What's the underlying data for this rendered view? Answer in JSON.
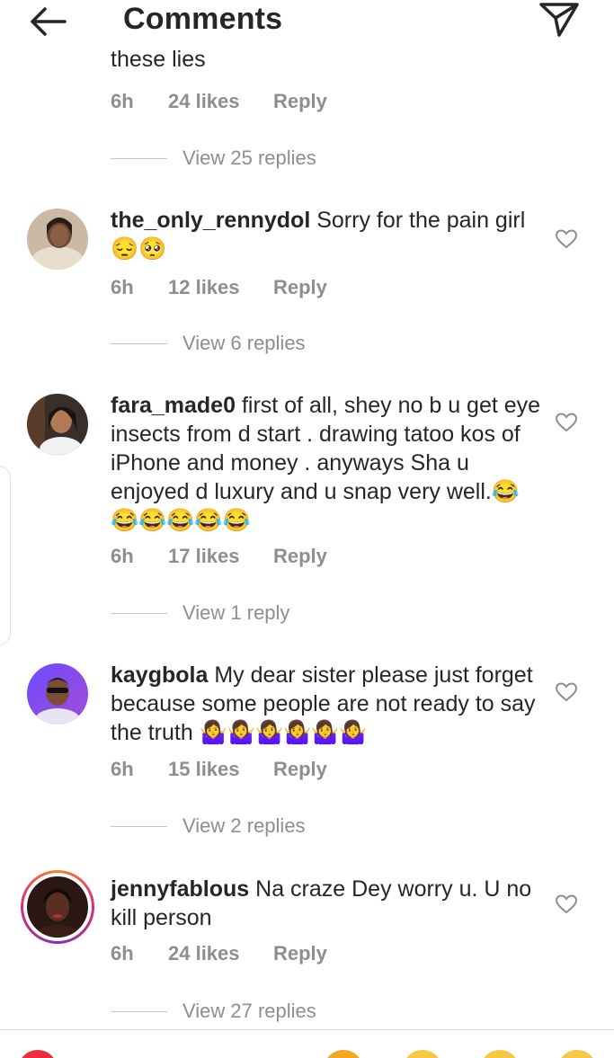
{
  "header": {
    "title": "Comments"
  },
  "prev": {
    "clipped_text": "these lies",
    "time": "6h",
    "likes": "24 likes",
    "reply": "Reply",
    "view_replies": "View 25 replies"
  },
  "comments": [
    {
      "username": "the_only_rennydol",
      "text": "Sorry for the pain girl",
      "emoji": "😔🥺",
      "time": "6h",
      "likes": "12 likes",
      "reply": "Reply",
      "view_replies": "View 6 replies"
    },
    {
      "username": "fara_made0",
      "text": "first of all, shey no b u get eye insects from d start . drawing tatoo kos of iPhone and money . anyways Sha u enjoyed d luxury and u snap very well.",
      "emoji": "😂😂😂😂😂😂",
      "time": "6h",
      "likes": "17 likes",
      "reply": "Reply",
      "view_replies": "View 1 reply"
    },
    {
      "username": "kaygbola",
      "text": "My dear sister please just forget because some people are not ready to say the truth",
      "emoji": "🤷‍♀️🤷‍♀️🤷‍♀️🤷‍♀️🤷‍♀️🤷‍♀️",
      "time": "6h",
      "likes": "15 likes",
      "reply": "Reply",
      "view_replies": "View 2 replies"
    },
    {
      "username": "jennyfablous",
      "text": "Na craze Dey worry u.  U no kill person",
      "emoji": "",
      "time": "6h",
      "likes": "24 likes",
      "reply": "Reply",
      "view_replies": "View 27 replies"
    }
  ],
  "colors": {
    "text": "#262626",
    "secondary": "#8e8e8e",
    "divider": "#c7c7c7"
  },
  "icons": [
    "back-arrow-icon",
    "send-icon",
    "heart-icon"
  ]
}
